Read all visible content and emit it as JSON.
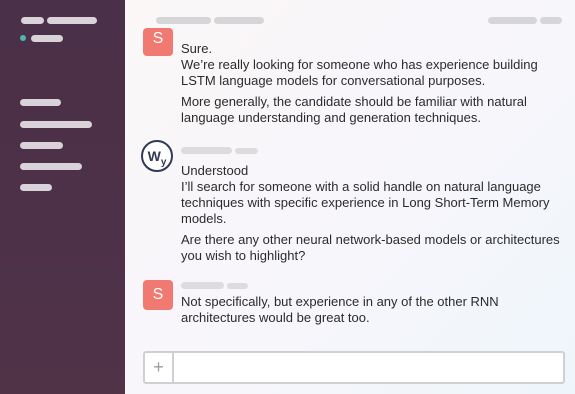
{
  "colors": {
    "sidebar_bg": "#4b3049",
    "status_dot": "#4fb6ad",
    "user_avatar_bg": "#f07a72",
    "bot_avatar_border": "#2f3a55",
    "text": "#2b2b2b"
  },
  "messages": [
    {
      "avatar_letter": "S",
      "paragraphs": [
        "Sure.",
        "We’re really looking for someone who has experience building LSTM language models for conversational purposes.",
        "More generally, the candidate should be familiar with natural language understanding and generation techniques."
      ]
    },
    {
      "avatar_letter": "W",
      "avatar_sub": "y",
      "paragraphs": [
        "Understood",
        "I’ll search for someone with a solid handle on natural language techniques with specific experience in Long Short-Term Memory models.",
        "Are there any other neural network-based models or architectures you wish to highlight?"
      ]
    },
    {
      "avatar_letter": "S",
      "paragraphs": [
        "Not specifically, but experience in any of the other RNN architectures would be great too."
      ]
    }
  ],
  "composer": {
    "plus_icon": "+",
    "placeholder": ""
  }
}
